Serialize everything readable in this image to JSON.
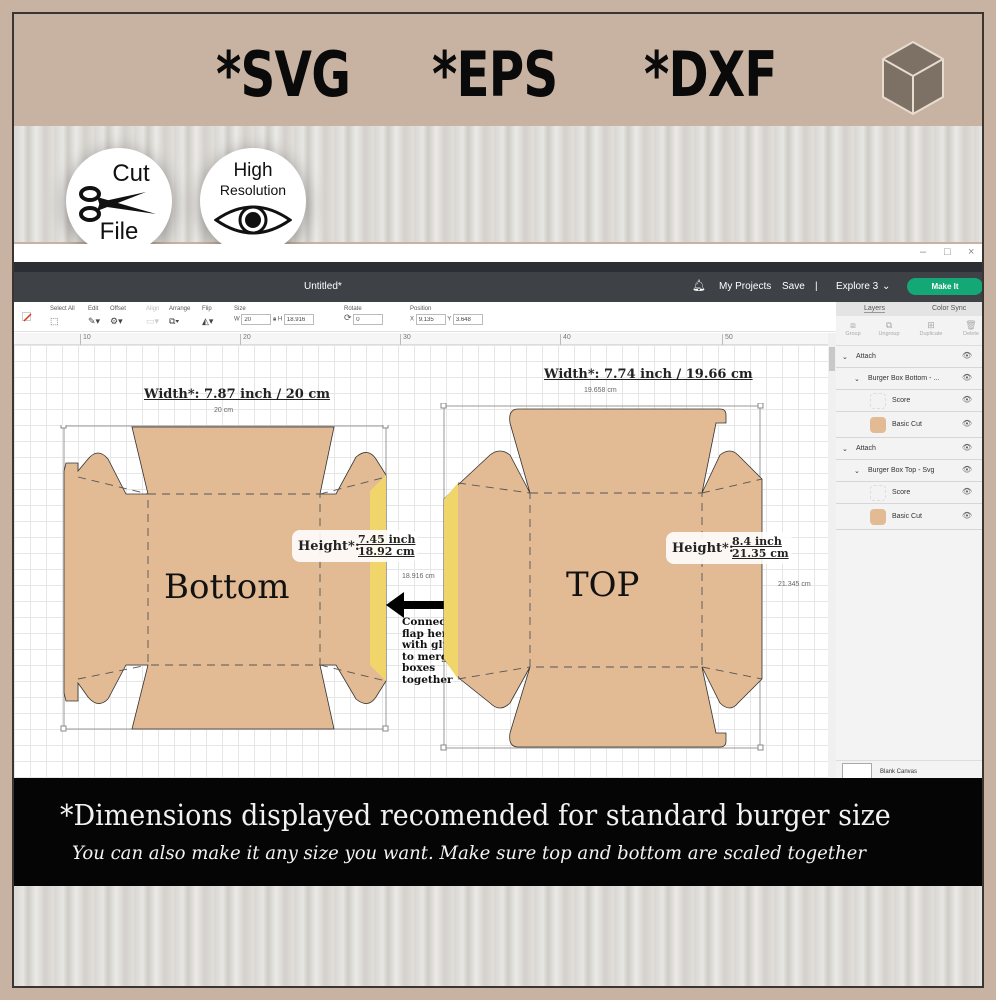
{
  "header": {
    "formats": [
      "*SVG",
      "*EPS",
      "*DXF"
    ],
    "logo_icon": "cube-icon"
  },
  "badges": {
    "cut_file": {
      "top": "Cut",
      "bottom": "File",
      "icon": "scissors-icon"
    },
    "high_res": {
      "line1": "High",
      "line2": "Resolution",
      "icon": "eye-icon"
    }
  },
  "app": {
    "window_controls": [
      "–",
      "□",
      "×"
    ],
    "document_title": "Untitled*",
    "nav": {
      "bell_icon": "bell-icon",
      "my_projects": "My Projects",
      "save": "Save",
      "separator": "|",
      "machine": "Explore 3",
      "machine_chevron": "⌄",
      "make_it": "Make It"
    },
    "toolbar": {
      "select_all": "Select All",
      "edit": "Edit",
      "offset": "Offset",
      "align": "Align",
      "arrange": "Arrange",
      "flip": "Flip",
      "size": "Size",
      "w_label": "W",
      "w_value": "20",
      "h_label": "H",
      "h_value": "18.916",
      "rotate": "Rotate",
      "rotate_value": "0",
      "position": "Position",
      "x_label": "X",
      "x_value": "9.135",
      "y_label": "Y",
      "y_value": "3.648"
    },
    "ruler": [
      "10",
      "20",
      "30",
      "40",
      "50"
    ],
    "panel": {
      "tabs": [
        "Layers",
        "Color Sync"
      ],
      "actions": [
        "Group",
        "Ungroup",
        "Duplicate",
        "Delete"
      ],
      "layers": [
        {
          "name": "Attach",
          "level": 0,
          "type": "group"
        },
        {
          "name": "Burger Box Bottom - ...",
          "level": 1,
          "type": "group"
        },
        {
          "name": "Score",
          "level": 2,
          "type": "score"
        },
        {
          "name": "Basic Cut",
          "level": 2,
          "type": "cut",
          "color": "#e2bb94"
        },
        {
          "name": "Attach",
          "level": 0,
          "type": "group"
        },
        {
          "name": "Burger Box Top - Svg",
          "level": 1,
          "type": "group"
        },
        {
          "name": "Score",
          "level": 2,
          "type": "score"
        },
        {
          "name": "Basic Cut",
          "level": 2,
          "type": "cut",
          "color": "#e2bb94"
        }
      ],
      "blank_canvas": "Blank Canvas"
    },
    "canvas": {
      "bottom": {
        "label": "Bottom",
        "width_label": "Width*: 7.87 inch / 20 cm",
        "width_small": "20 cm",
        "height_title": "Height*:",
        "height_inch": "7.45 inch",
        "height_cm": "18.92 cm",
        "height_small": "18.916 cm"
      },
      "top": {
        "label": "TOP",
        "width_label": "Width*: 7.74 inch / 19.66 cm",
        "width_small": "19.658 cm",
        "height_title": "Height*:",
        "height_inch": "8.4 inch",
        "height_cm": "21.35 cm",
        "height_small": "21.345 cm"
      },
      "connect_note": [
        "Connect",
        "flap here",
        "with glue",
        "to merge",
        "boxes",
        "together"
      ],
      "colors": {
        "cut": "#e2bb94",
        "glue_flap": "#f0d56b"
      }
    }
  },
  "footer": {
    "line1": "*Dimensions displayed recomended for standard burger size",
    "line2": "You can also make it any size you want. Make sure top and bottom are scaled together"
  }
}
